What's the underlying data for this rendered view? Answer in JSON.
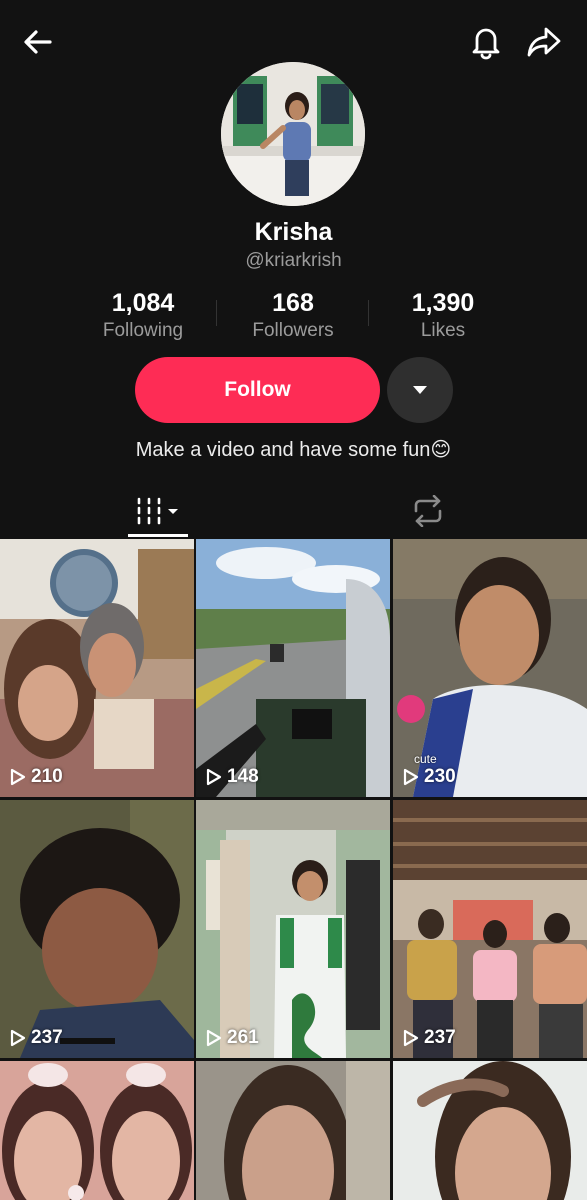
{
  "header": {
    "back_icon": "arrow-left-icon",
    "bell_icon": "bell-icon",
    "share_icon": "share-icon"
  },
  "profile": {
    "name": "Krisha",
    "handle": "@kriarkrish",
    "bio": "Make a video and have some fun😊",
    "stats": {
      "following_count": "1,084",
      "following_label": "Following",
      "followers_count": "168",
      "followers_label": "Followers",
      "likes_count": "1,390",
      "likes_label": "Likes"
    },
    "follow_label": "Follow",
    "accent_color": "#fe2c55"
  },
  "tabs": {
    "videos_icon": "videos-grid-icon",
    "reposts_icon": "repost-icon"
  },
  "videos": [
    {
      "views": "210",
      "caption": ""
    },
    {
      "views": "148",
      "caption": ""
    },
    {
      "views": "230",
      "caption": "cute"
    },
    {
      "views": "237",
      "caption": ""
    },
    {
      "views": "261",
      "caption": ""
    },
    {
      "views": "237",
      "caption": ""
    },
    {
      "views": "",
      "caption": ""
    },
    {
      "views": "",
      "caption": ""
    },
    {
      "views": "",
      "caption": ""
    }
  ]
}
